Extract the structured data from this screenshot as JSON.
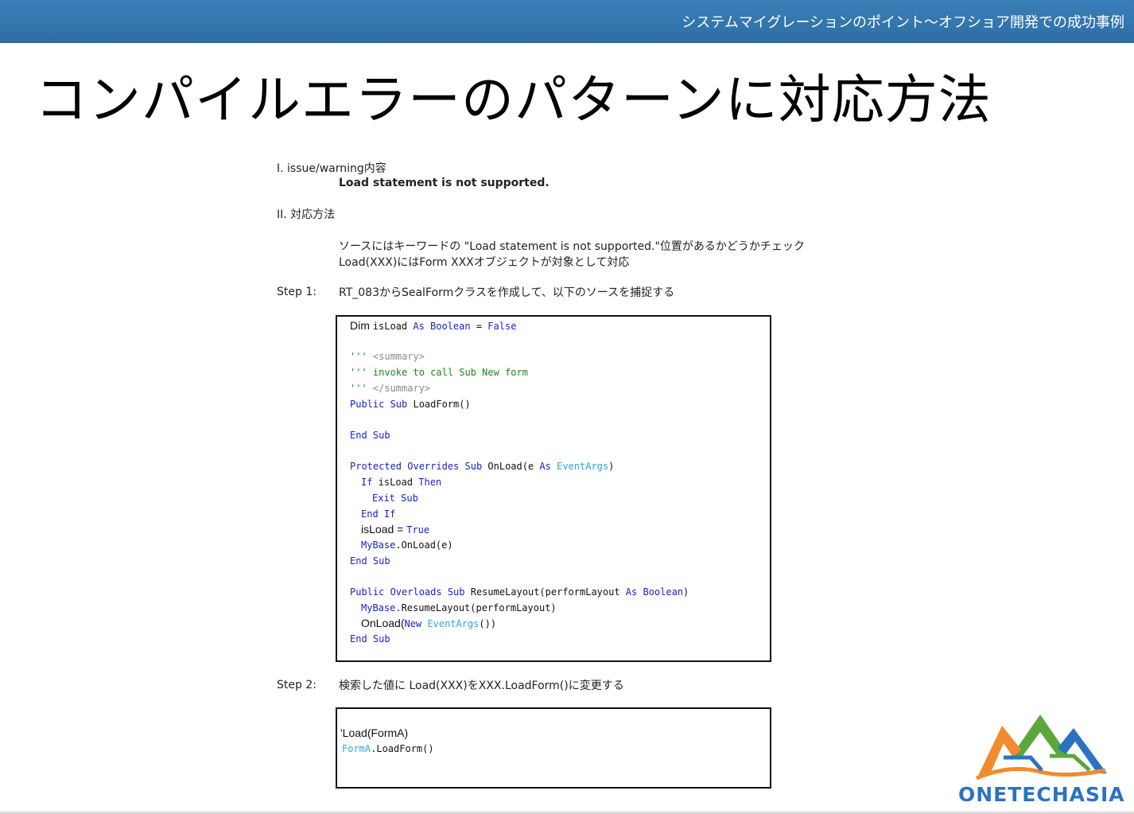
{
  "header": {
    "title": "システムマイグレーションのポイント〜オフショア開発での成功事例"
  },
  "slide": {
    "title": "コンパイルエラーのパターンに対応方法"
  },
  "doc": {
    "section1_label": "I. issue/warning内容",
    "section1_body": "Load statement is not supported.",
    "section2_label": "II. 対応方法",
    "desc_line1": "ソースにはキーワードの \"Load statement is not supported.\"位置があるかどうかチェック",
    "desc_line2": "Load(XXX)にはForm XXXオブジェクトが対象として対応",
    "step1_label": "Step 1:",
    "step1_text": "RT_083からSealFormクラスを作成して、以下のソースを捕捉する",
    "step2_label": "Step 2:",
    "step2_text": "検索した値に Load(XXX)をXXX.LoadForm()に変更する"
  },
  "code1": {
    "l1a": "Dim ",
    "l1b": "isLoad ",
    "l1c": "As Boolean",
    "l1d": " = ",
    "l1e": "False",
    "l2a": "''' ",
    "l2b": "<summary>",
    "l3": "''' invoke to call Sub New form",
    "l4a": "''' ",
    "l4b": "</summary>",
    "l5a": "Public Sub",
    "l5b": " LoadForm()",
    "l6": "End Sub",
    "l7a": "Protected Overrides Sub",
    "l7b": " OnLoad(e ",
    "l7c": "As",
    "l7d": " EventArgs",
    "l7e": ")",
    "l8a": "If",
    "l8b": " isLoad ",
    "l8c": "Then",
    "l9": "Exit Sub",
    "l10": "End If",
    "l11a": "isLoad = ",
    "l11b": "True",
    "l12a": "MyBase",
    "l12b": ".OnLoad(e)",
    "l13": "End Sub",
    "l14a": "Public Overloads Sub",
    "l14b": " ResumeLayout(performLayout ",
    "l14c": "As Boolean",
    "l14d": ")",
    "l15a": "MyBase",
    "l15b": ".ResumeLayout(performLayout)",
    "l16a": "OnLoad(",
    "l16b": "New",
    "l16c": " EventArgs",
    "l16d": "())",
    "l17": "End Sub"
  },
  "code2": {
    "l1": "'Load(FormA)",
    "l2a": "FormA",
    "l2b": ".LoadForm()"
  },
  "logo": {
    "text": "ONETECHASIA",
    "colors": {
      "blue": "#2b73c2",
      "green": "#5aa83c",
      "orange": "#f28a2e"
    }
  }
}
